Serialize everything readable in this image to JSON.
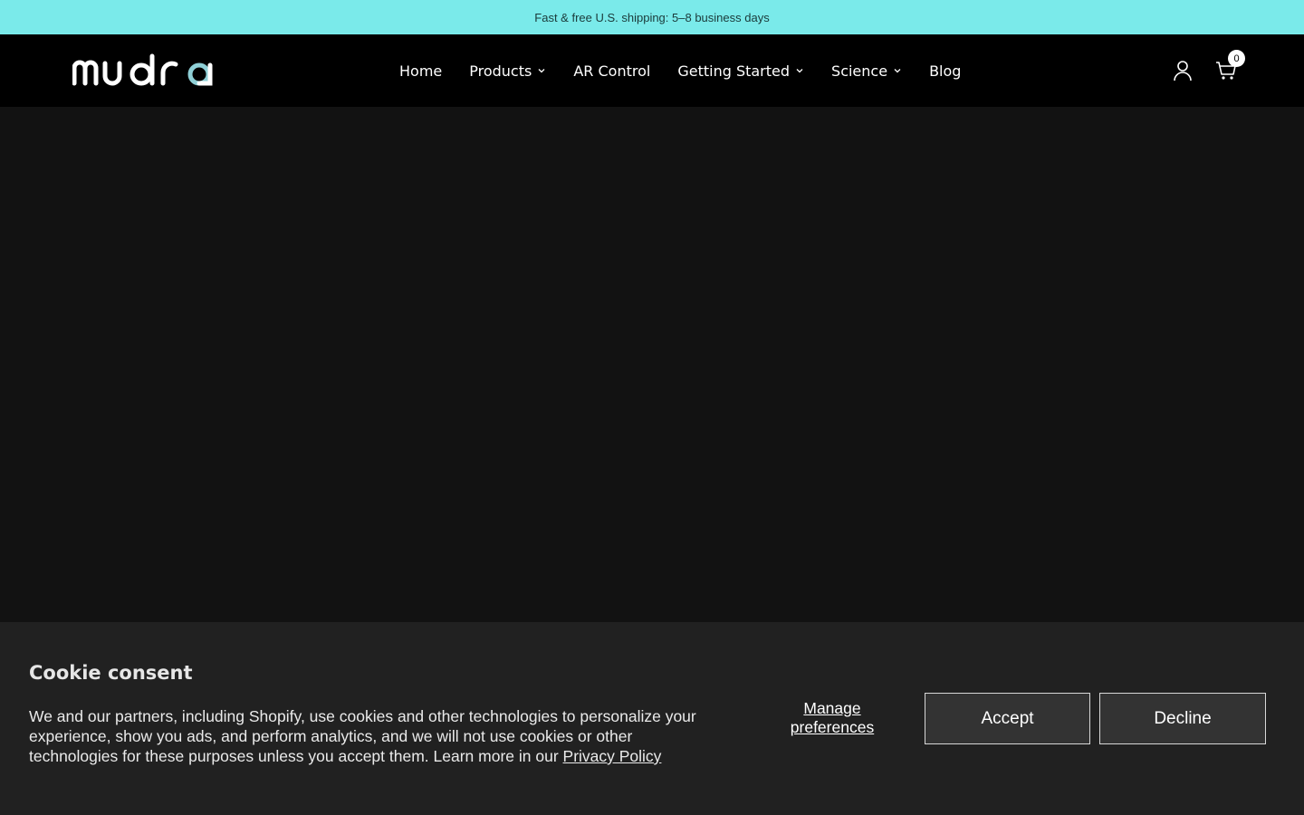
{
  "announcement": {
    "text": "Fast & free U.S. shipping: 5–8 business days"
  },
  "header": {
    "logo_text": "mudra",
    "nav": [
      {
        "label": "Home",
        "dropdown": false
      },
      {
        "label": "Products",
        "dropdown": true
      },
      {
        "label": "AR Control",
        "dropdown": false
      },
      {
        "label": "Getting Started",
        "dropdown": true
      },
      {
        "label": "Science",
        "dropdown": true
      },
      {
        "label": "Blog",
        "dropdown": false
      }
    ],
    "account_icon": "user-icon",
    "cart_icon": "cart-icon",
    "cart_count": "0"
  },
  "cookie": {
    "title": "Cookie consent",
    "text": "We and our partners, including Shopify, use cookies and other technologies to personalize your experience, show you ads, and perform analytics, and we will not use cookies or other technologies for these purposes unless you accept them. Learn more in our ",
    "privacy_link": "Privacy Policy",
    "manage_label": "Manage preferences",
    "accept_label": "Accept",
    "decline_label": "Decline"
  },
  "colors": {
    "announcement_bg": "#7aeaea",
    "header_bg": "#000000",
    "page_bg": "#121212",
    "cookie_bg": "#212121",
    "logo_accent": "#8ecfd6"
  }
}
